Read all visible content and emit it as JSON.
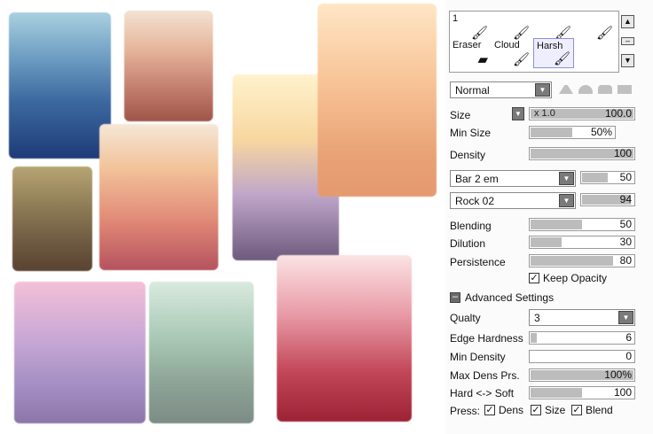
{
  "tools": [
    {
      "label": "1",
      "icon": "brush-icon"
    },
    {
      "label": "",
      "icon": "brush-icon"
    },
    {
      "label": "",
      "icon": "brush-icon"
    },
    {
      "label": "",
      "icon": "brush-icon"
    },
    {
      "label": "Eraser",
      "icon": "eraser-icon"
    },
    {
      "label": "Cloud",
      "icon": "brush-icon"
    },
    {
      "label": "Harsh",
      "icon": "brush-icon"
    }
  ],
  "blend_mode": "Normal",
  "size": {
    "label": "Size",
    "multiplier": "x 1.0",
    "value": "100.0"
  },
  "min_size": {
    "label": "Min Size",
    "value": "50%",
    "fraction": 0.5
  },
  "density": {
    "label": "Density",
    "value": "100",
    "fraction": 1.0
  },
  "shape_tex": {
    "name": "Bar 2 em",
    "value": "50",
    "fraction": 0.5
  },
  "brush_tex": {
    "name": "Rock 02",
    "value": "94",
    "fraction": 0.94
  },
  "blending": {
    "label": "Blending",
    "value": "50",
    "fraction": 0.5
  },
  "dilution": {
    "label": "Dilution",
    "value": "30",
    "fraction": 0.3
  },
  "persistence": {
    "label": "Persistence",
    "value": "80",
    "fraction": 0.8
  },
  "keep_opacity": {
    "label": "Keep Opacity",
    "checked": true
  },
  "advanced": {
    "label": "Advanced Settings"
  },
  "quality": {
    "label": "Qualty",
    "value": "3"
  },
  "edge_hardness": {
    "label": "Edge Hardness",
    "value": "6",
    "fraction": 0.06
  },
  "min_density": {
    "label": "Min Density",
    "value": "0",
    "fraction": 0.0
  },
  "max_dens_prs": {
    "label": "Max Dens Prs.",
    "value": "100%",
    "fraction": 1.0
  },
  "hard_soft": {
    "label": "Hard <-> Soft",
    "value": "100",
    "fraction": 0.5
  },
  "press": {
    "label": "Press:",
    "dens": "Dens",
    "size": "Size",
    "blend": "Blend"
  }
}
